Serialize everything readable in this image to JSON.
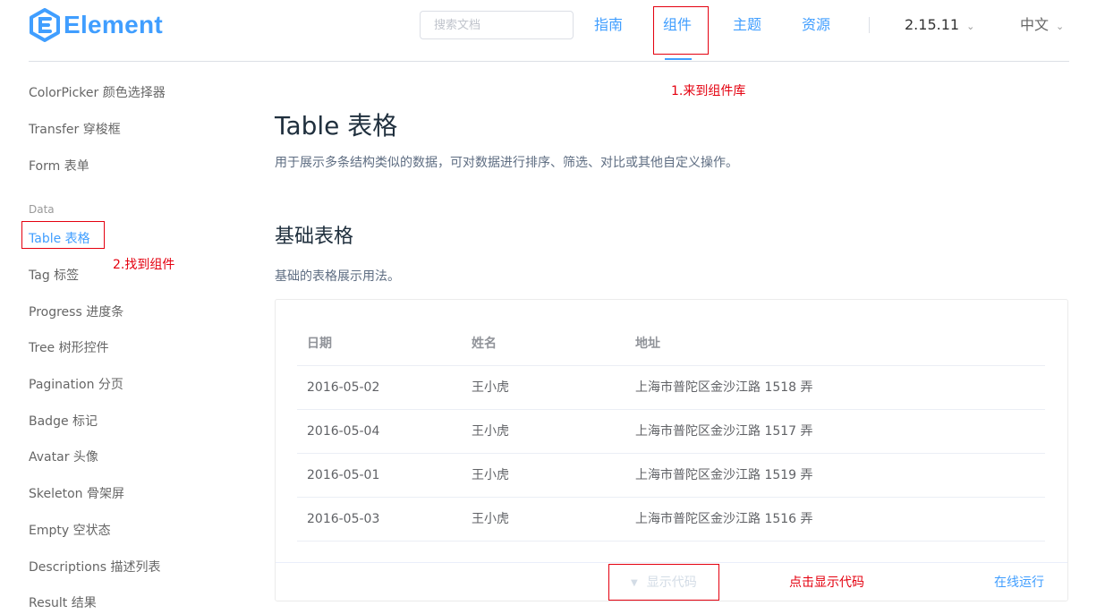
{
  "header": {
    "logo_text": "Element",
    "search_placeholder": "搜索文档",
    "nav": {
      "guide": "指南",
      "component": "组件",
      "theme": "主题",
      "resource": "资源"
    },
    "version": "2.15.11",
    "language": "中文",
    "accent_color": "#409eff"
  },
  "annotations": {
    "step1": "1.来到组件库",
    "step2": "2.找到组件",
    "step3": "点击显示代码",
    "color": "#e4000f"
  },
  "sidebar": {
    "items_top": [
      "ColorPicker 颜色选择器",
      "Transfer 穿梭框",
      "Form 表单"
    ],
    "group_label": "Data",
    "active_item": "Table 表格",
    "items_bottom": [
      "Tag 标签",
      "Progress 进度条",
      "Tree 树形控件",
      "Pagination 分页",
      "Badge 标记",
      "Avatar 头像",
      "Skeleton 骨架屏",
      "Empty 空状态",
      "Descriptions 描述列表",
      "Result 结果"
    ]
  },
  "main": {
    "title": "Table 表格",
    "description": "用于展示多条结构类似的数据，可对数据进行排序、筛选、对比或其他自定义操作。",
    "section_title": "基础表格",
    "section_description": "基础的表格展示用法。",
    "table": {
      "columns": [
        "日期",
        "姓名",
        "地址"
      ],
      "rows": [
        [
          "2016-05-02",
          "王小虎",
          "上海市普陀区金沙江路 1518 弄"
        ],
        [
          "2016-05-04",
          "王小虎",
          "上海市普陀区金沙江路 1517 弄"
        ],
        [
          "2016-05-01",
          "王小虎",
          "上海市普陀区金沙江路 1519 弄"
        ],
        [
          "2016-05-03",
          "王小虎",
          "上海市普陀区金沙江路 1516 弄"
        ]
      ]
    },
    "show_code_label": "显示代码",
    "run_online_label": "在线运行"
  }
}
